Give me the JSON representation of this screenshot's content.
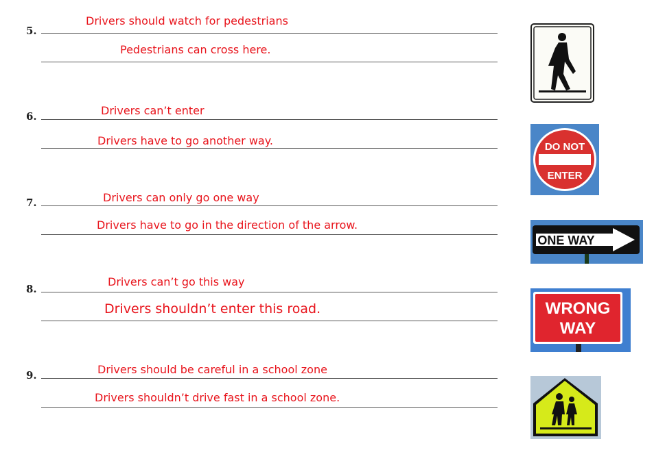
{
  "items": [
    {
      "number": "5.",
      "answer1": "Drivers should watch for pedestrians",
      "answer2": "Pedestrians can cross here.",
      "sign": "pedestrian-crossing"
    },
    {
      "number": "6.",
      "answer1": "Drivers can’t enter",
      "answer2": "Drivers have to go another way.",
      "sign": "do-not-enter",
      "sign_text": [
        "DO NOT",
        "ENTER"
      ]
    },
    {
      "number": "7.",
      "answer1": "Drivers can only go one way",
      "answer2": "Drivers have to go in the direction of the arrow.",
      "sign": "one-way",
      "sign_text": "ONE WAY"
    },
    {
      "number": "8.",
      "answer1": "Drivers can’t go this way",
      "answer2": "Drivers shouldn’t enter this road.",
      "sign": "wrong-way",
      "sign_text": [
        "WRONG",
        "WAY"
      ]
    },
    {
      "number": "9.",
      "answer1": "Drivers should be careful in a school zone",
      "answer2": "Drivers shouldn’t drive fast in a school zone.",
      "sign": "school-crossing"
    }
  ],
  "colors": {
    "answer": "#e8141c",
    "do_not_enter": "#d9312f",
    "wrong_way": "#e0252e",
    "school_sign": "#d6ea1a",
    "sky": "#4a86c8"
  }
}
